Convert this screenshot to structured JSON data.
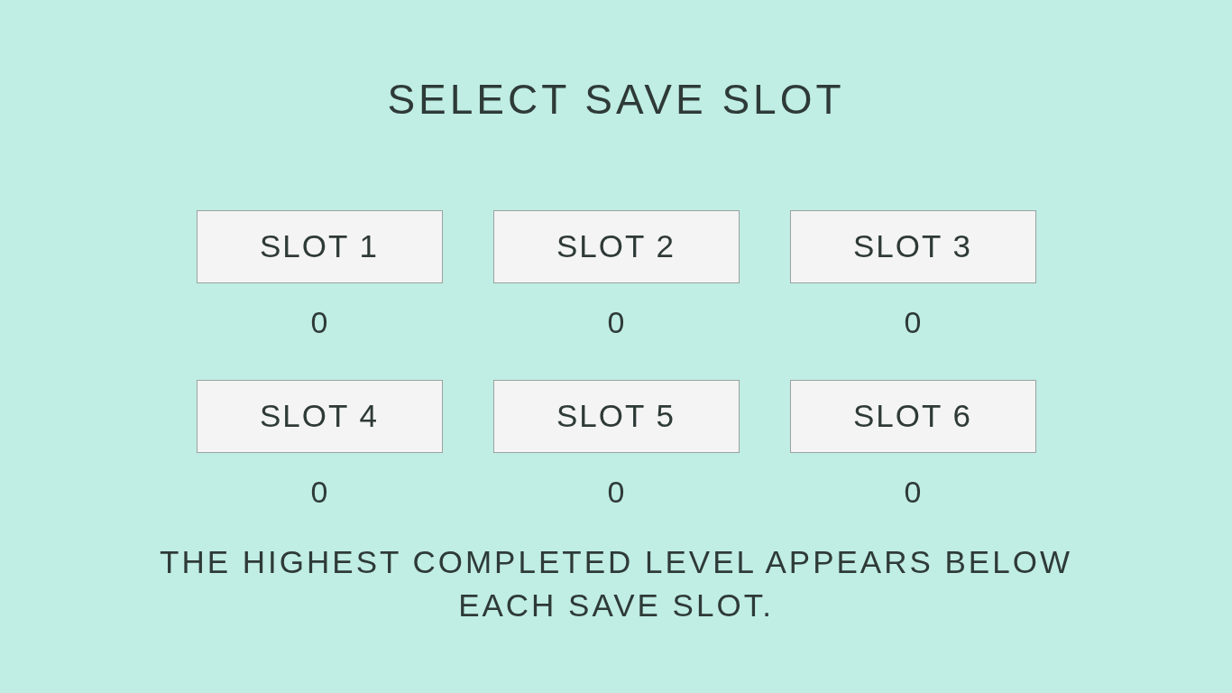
{
  "title": "SELECT SAVE SLOT",
  "slots": [
    {
      "label": "SLOT 1",
      "level": "0"
    },
    {
      "label": "SLOT 2",
      "level": "0"
    },
    {
      "label": "SLOT 3",
      "level": "0"
    },
    {
      "label": "SLOT 4",
      "level": "0"
    },
    {
      "label": "SLOT 5",
      "level": "0"
    },
    {
      "label": "SLOT 6",
      "level": "0"
    }
  ],
  "hint": "THE HIGHEST COMPLETED LEVEL APPEARS BELOW EACH SAVE SLOT."
}
